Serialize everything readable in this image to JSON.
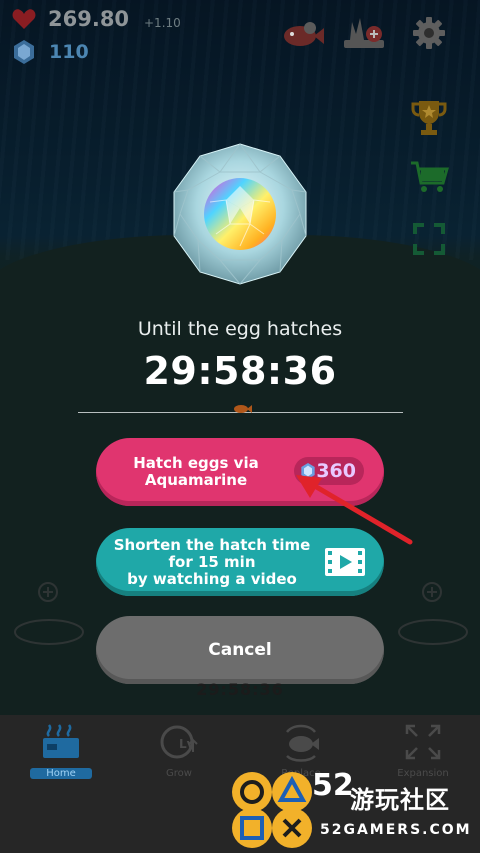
{
  "hud": {
    "hearts": "269.80",
    "rate": "+1.10",
    "gems": "110"
  },
  "dialog": {
    "hatch_label": "Until the egg hatches",
    "timer": "29:58:36",
    "hatch_button": [
      "Hatch eggs via",
      "Aquamarine"
    ],
    "hatch_cost": "360",
    "video_button": [
      "Shorten the hatch time",
      "for 15 min",
      "by watching a video"
    ],
    "cancel_button": "Cancel"
  },
  "background_timer": "29:58:36",
  "nav": {
    "items": [
      {
        "label": "Home",
        "icon": "aquarium-icon",
        "active": true
      },
      {
        "label": "Grow",
        "icon": "level-up-icon",
        "active": false
      },
      {
        "label": "Replace",
        "icon": "fish-swap-icon",
        "active": false
      },
      {
        "label": "Expansion",
        "icon": "expand-icon",
        "active": false
      }
    ]
  },
  "watermark": {
    "number": "52",
    "chinese": "游玩社区",
    "site": "52GAMERS.COM"
  },
  "colors": {
    "hatch_button": "#e0356f",
    "video_button": "#1fa8a8",
    "cancel_button": "#6d6d6d",
    "arrow": "#e0232a"
  }
}
